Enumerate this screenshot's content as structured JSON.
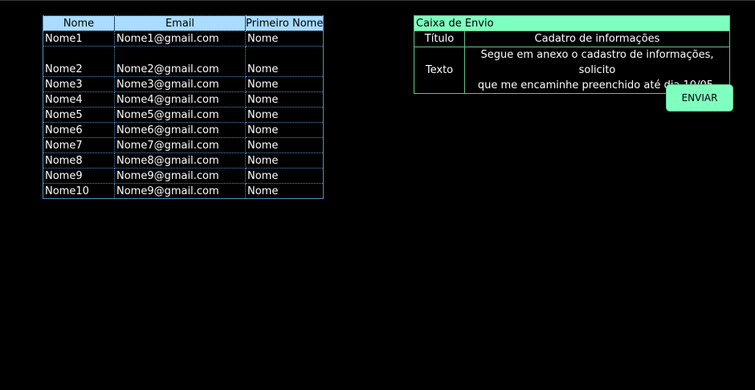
{
  "contacts": {
    "headers": [
      "Nome",
      "Email",
      "Primeiro Nome"
    ],
    "rows": [
      [
        "Nome1",
        "Nome1@gmail.com",
        "Nome"
      ],
      [
        "Nome2",
        "Nome2@gmail.com",
        "Nome"
      ],
      [
        "Nome3",
        "Nome3@gmail.com",
        "Nome"
      ],
      [
        "Nome4",
        "Nome4@gmail.com",
        "Nome"
      ],
      [
        "Nome5",
        "Nome5@gmail.com",
        "Nome"
      ],
      [
        "Nome6",
        "Nome6@gmail.com",
        "Nome"
      ],
      [
        "Nome7",
        "Nome7@gmail.com",
        "Nome"
      ],
      [
        "Nome8",
        "Nome8@gmail.com",
        "Nome"
      ],
      [
        "Nome9",
        "Nome9@gmail.com",
        "Nome"
      ],
      [
        "Nome10",
        "Nome9@gmail.com",
        "Nome"
      ]
    ]
  },
  "sendbox": {
    "header": "Caixa de Envio",
    "title_label": "Título",
    "title_value": "Cadatro de informações",
    "text_label": "Texto",
    "text_value_line1": "Segue em anexo o cadastro de informações, solicito",
    "text_value_line2": "que me encaminhe preenchido até dia 10/05."
  },
  "actions": {
    "send_label": "ENVIAR"
  },
  "colors": {
    "background": "#000000",
    "contacts_header": "#a9dcff",
    "sendbox_header": "#7fffbf",
    "send_button": "#7fffbf"
  }
}
